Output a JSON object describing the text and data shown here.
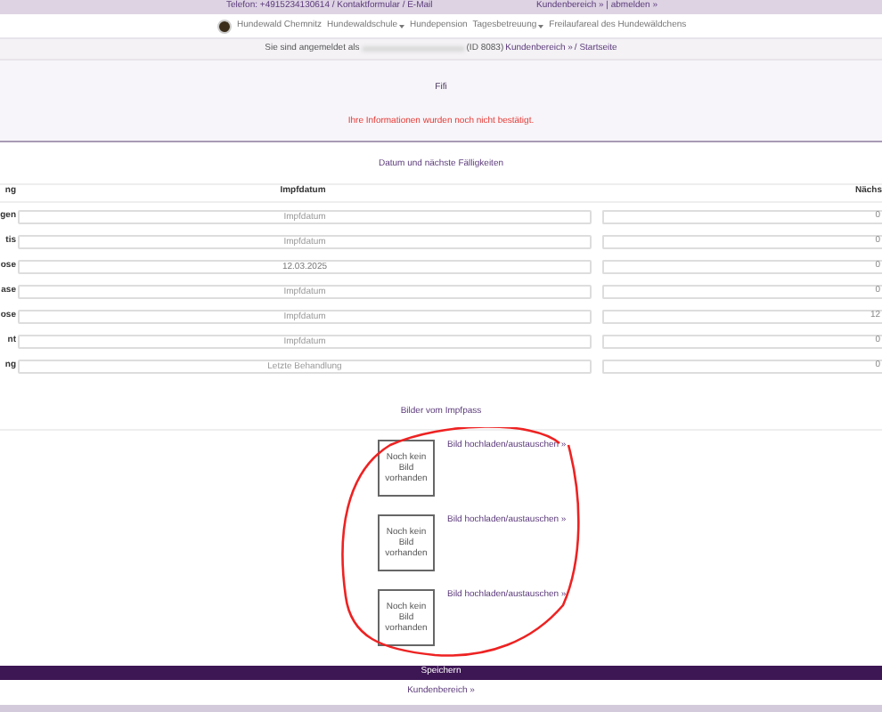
{
  "top_bar": {
    "contact": "Telefon: +4915234130614 / Kontaktformular / E-Mail",
    "account": "Kundenbereich » | abmelden »"
  },
  "nav": {
    "items": [
      {
        "label": "Hundewald Chemnitz",
        "dropdown": false
      },
      {
        "label": "Hundewaldschule",
        "dropdown": true
      },
      {
        "label": "Hundepension",
        "dropdown": false
      },
      {
        "label": "Tagesbetreuung",
        "dropdown": true
      },
      {
        "label": "Freilaufareal des Hundewäldchens",
        "dropdown": false
      }
    ]
  },
  "breadcrumb": {
    "prefix": "Sie sind angemeldet als",
    "suffix": "(ID 8083)",
    "link": "Kundenbereich »",
    "current": "/ Startseite"
  },
  "dog_name": "Fifi",
  "warning": "Ihre Informationen wurden noch nicht bestätigt.",
  "vaccinations": {
    "title": "Datum und nächste Fälligkeiten",
    "columns": [
      "ng",
      "Impfdatum",
      "Nächs"
    ],
    "rows": [
      {
        "label": "gen",
        "date": {
          "placeholder": "Impfdatum"
        },
        "next": "0"
      },
      {
        "label": "tis",
        "date": {
          "placeholder": "Impfdatum"
        },
        "next": "0"
      },
      {
        "label": "ose",
        "date": {
          "value": "12.03.2025"
        },
        "next": "0"
      },
      {
        "label": "ase",
        "date": {
          "placeholder": "Impfdatum"
        },
        "next": "0"
      },
      {
        "label": "ose",
        "date": {
          "placeholder": "Impfdatum"
        },
        "next": "12"
      },
      {
        "label": "nt",
        "date": {
          "placeholder": "Impfdatum"
        },
        "next": "0"
      },
      {
        "label": "ng",
        "date": {
          "placeholder": "Letzte Behandlung"
        },
        "next": "0"
      }
    ]
  },
  "images": {
    "title": "Bilder vom Impfpass",
    "items": [
      {
        "empty_text": "Noch kein Bild vorhanden",
        "link": "Bild hochladen/austauschen »"
      },
      {
        "empty_text": "Noch kein Bild vorhanden",
        "link": "Bild hochladen/austauschen »"
      },
      {
        "empty_text": "Noch kein Bild vorhanden",
        "link": "Bild hochladen/austauschen »"
      }
    ]
  },
  "save_button": "Speichern",
  "footer_link": "Kundenbereich »"
}
